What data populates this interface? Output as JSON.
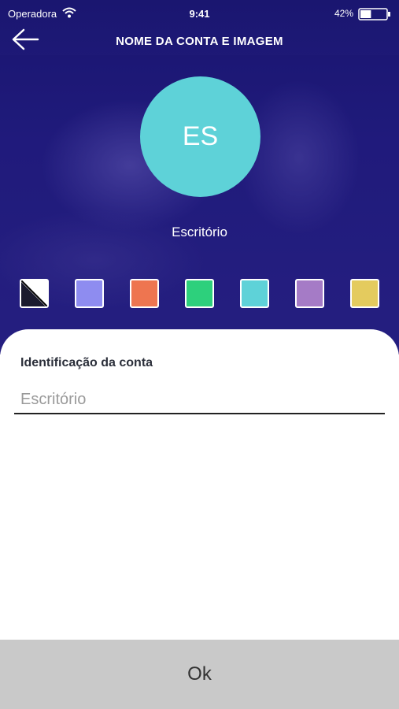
{
  "status_bar": {
    "carrier": "Operadora",
    "time": "9:41",
    "battery_percent": "42%",
    "wifi_icon": "wifi-icon",
    "battery_icon": "battery-icon",
    "battery_level": 0.42
  },
  "header": {
    "title": "NOME DA CONTA E IMAGEM",
    "back_icon": "arrow-left-icon"
  },
  "avatar": {
    "initials": "ES",
    "color": "#5ED2D8"
  },
  "account_name": "Escritório",
  "color_swatches": [
    {
      "name": "none",
      "color": "#FFFFFF"
    },
    {
      "name": "lavender",
      "color": "#8E8CF0"
    },
    {
      "name": "orange",
      "color": "#EE7550"
    },
    {
      "name": "green",
      "color": "#2DD07C"
    },
    {
      "name": "cyan",
      "color": "#5ED2D8"
    },
    {
      "name": "purple",
      "color": "#A57BC6"
    },
    {
      "name": "yellow",
      "color": "#E4CB5E"
    }
  ],
  "form": {
    "label": "Identificação da conta",
    "placeholder": "Escritório",
    "value": ""
  },
  "ok_label": "Ok"
}
